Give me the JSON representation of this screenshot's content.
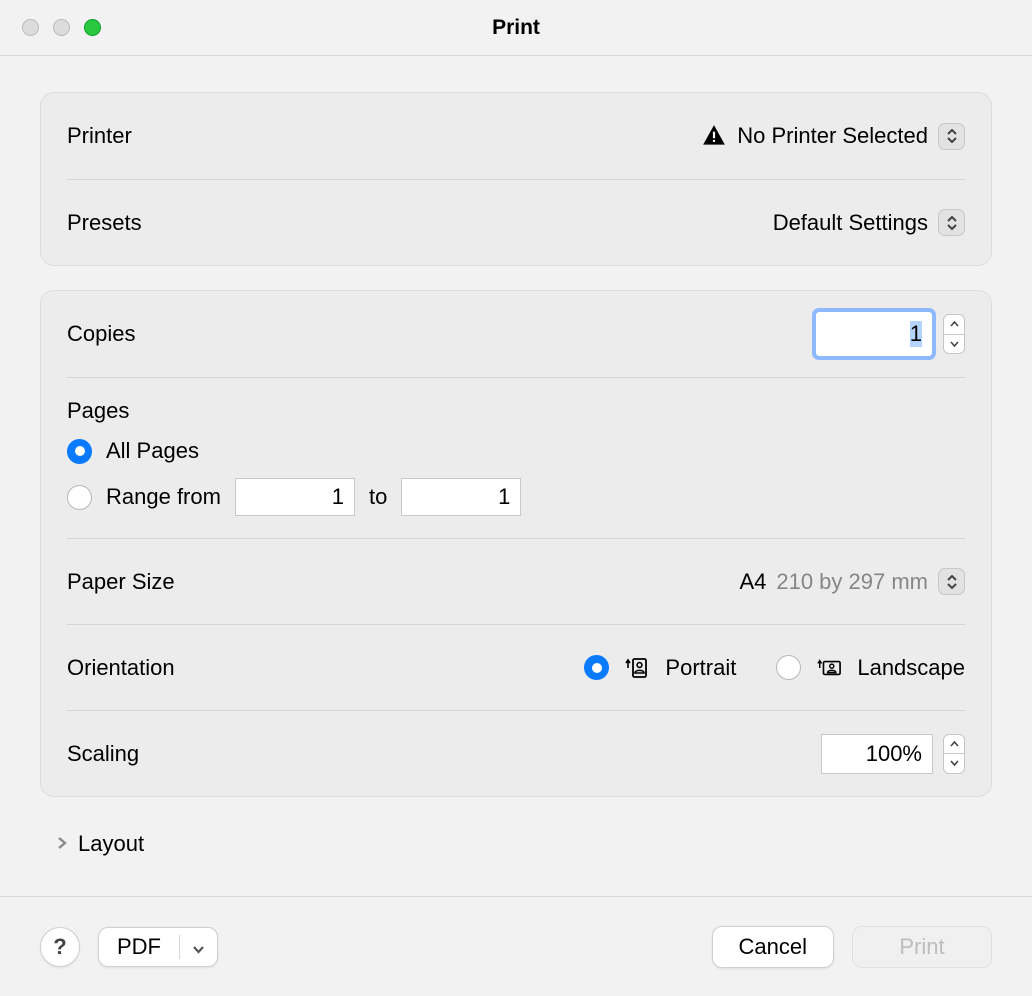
{
  "title": "Print",
  "printer": {
    "label": "Printer",
    "value": "No Printer Selected"
  },
  "presets": {
    "label": "Presets",
    "value": "Default Settings"
  },
  "copies": {
    "label": "Copies",
    "value": "1"
  },
  "pages": {
    "label": "Pages",
    "all_label": "All Pages",
    "range_label": "Range from",
    "range_from": "1",
    "to_label": "to",
    "range_to": "1",
    "all_selected": true
  },
  "paper_size": {
    "label": "Paper Size",
    "value": "A4",
    "dimensions": "210 by 297 mm"
  },
  "orientation": {
    "label": "Orientation",
    "portrait_label": "Portrait",
    "landscape_label": "Landscape",
    "selected": "portrait"
  },
  "scaling": {
    "label": "Scaling",
    "value": "100%"
  },
  "layout_section": "Layout",
  "footer": {
    "help": "?",
    "pdf": "PDF",
    "cancel": "Cancel",
    "print": "Print"
  }
}
